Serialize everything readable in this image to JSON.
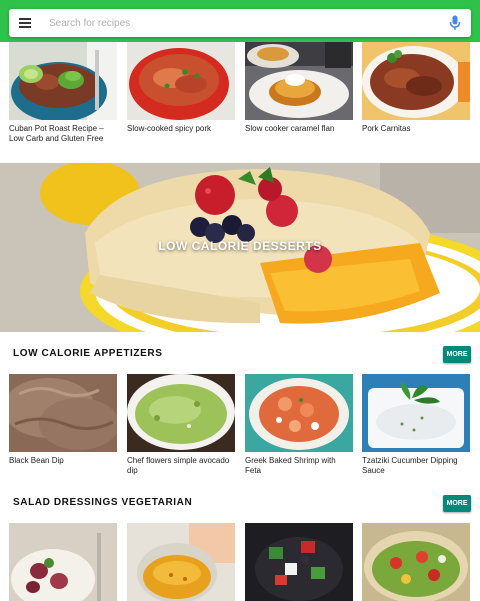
{
  "search": {
    "placeholder": "Search for recipes"
  },
  "top_cards": [
    {
      "caption": "Cuban Pot Roast Recipe – Low Carb and Gluten Free"
    },
    {
      "caption": "Slow-cooked spicy pork"
    },
    {
      "caption": "Slow cooker caramel flan"
    },
    {
      "caption": "Pork Carnitas"
    }
  ],
  "banner": {
    "title": "LOW CALORIE DESSERTS"
  },
  "sections": [
    {
      "title": "LOW CALORIE APPETIZERS",
      "more_label": "MORE",
      "cards": [
        {
          "caption": "Black Bean Dip"
        },
        {
          "caption": "Chef flowers simple avocado dip"
        },
        {
          "caption": "Greek Baked Shrimp with Feta"
        },
        {
          "caption": "Tzatziki Cucumber Dipping Sauce"
        }
      ]
    },
    {
      "title": "SALAD DRESSINGS VEGETARIAN",
      "more_label": "MORE",
      "cards": []
    }
  ],
  "colors": {
    "topbar": "#2ec24a",
    "more_button": "#00897b"
  }
}
